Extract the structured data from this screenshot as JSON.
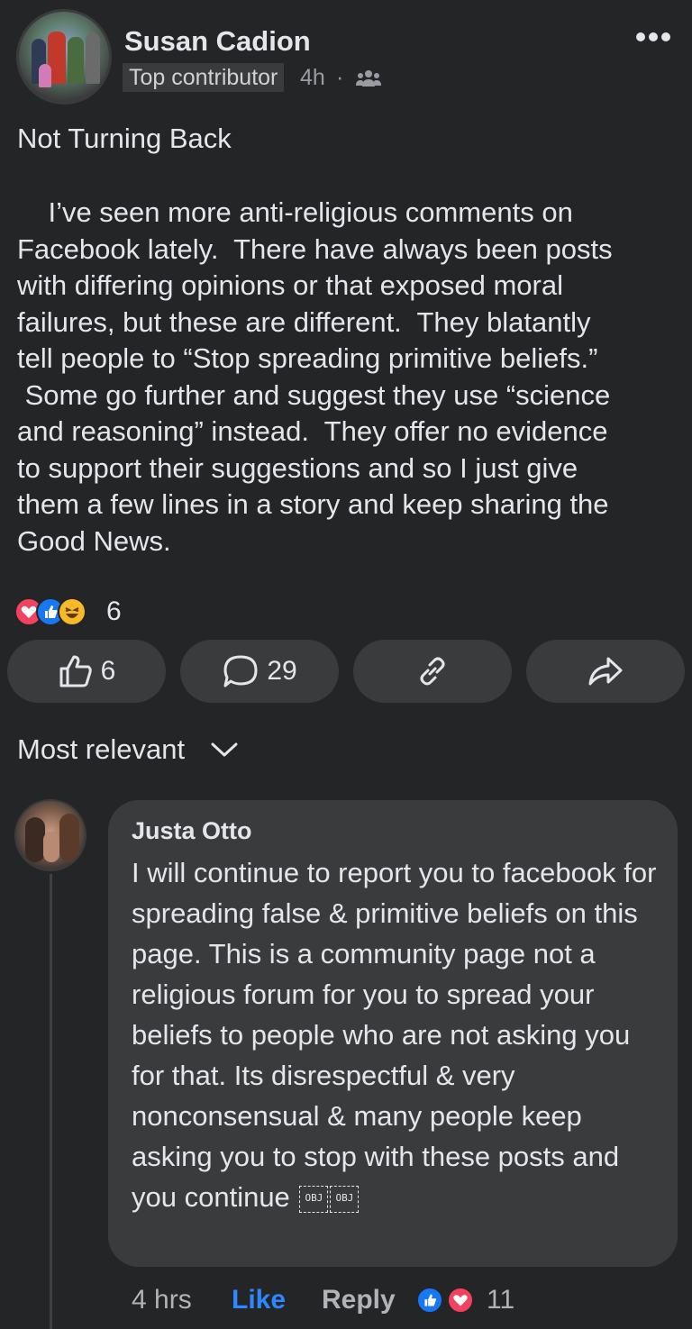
{
  "post": {
    "author": "Susan Cadion",
    "badge": "Top contributor",
    "time": "4h",
    "separator": "·",
    "audience_icon": "group-icon",
    "title": "Not Turning Back",
    "body": "    I’ve seen more anti-religious comments on\nFacebook lately.  There have always been posts\nwith differing opinions or that exposed moral\nfailures, but these are different.  They blatantly\ntell people to “Stop spreading primitive beliefs.”\n Some go further and suggest they use “science\nand reasoning” instead.  They offer no evidence\nto support their suggestions and so I just give\nthem a few lines in a story and keep sharing the\nGood News.",
    "reaction_count": "6",
    "reactions": [
      "love",
      "like",
      "haha"
    ]
  },
  "actions": {
    "like_count": "6",
    "comment_count": "29"
  },
  "sort": {
    "label": "Most relevant"
  },
  "comment": {
    "author": "Justa Otto",
    "text": "I will continue to report you to facebook for spreading false & primitive beliefs on this page. This is a community page not a religious forum for you to spread your beliefs to people who are not asking you for that. Its disrespectful & very nonconsensual & many people keep asking you to stop with these posts and you continue",
    "obj_glyphs": [
      "OBJ",
      "OBJ"
    ],
    "time": "4 hrs",
    "like_label": "Like",
    "reply_label": "Reply",
    "reaction_count": "11",
    "reactions": [
      "like",
      "love"
    ]
  },
  "colors": {
    "background": "#242526",
    "bubble": "#3a3b3c",
    "text": "#e4e6eb",
    "secondary": "#b0b3b8",
    "link_blue": "#2d88ff",
    "love_red": "#f3425f",
    "like_blue": "#1877f2",
    "haha_yellow": "#f7b928"
  }
}
